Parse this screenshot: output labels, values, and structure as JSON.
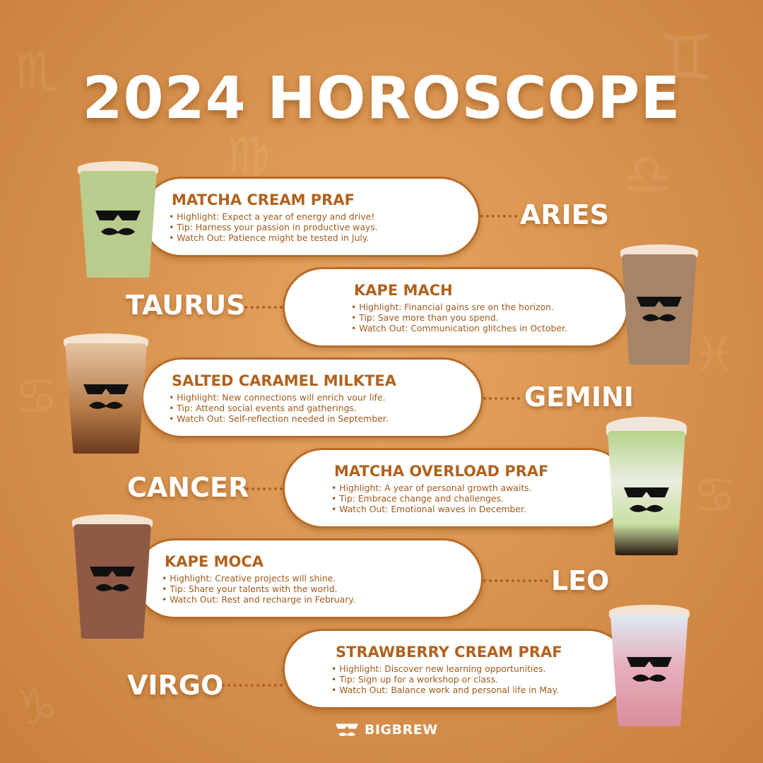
{
  "title": "2024 HOROSCOPE",
  "brand": "BIGBREW",
  "colors": {
    "background": "#d99450",
    "card_border": "#b86b26",
    "card_text": "#a05a1c",
    "sign_text": "#ffffff"
  },
  "entries": [
    {
      "sign": "ARIES",
      "drink": "MATCHA CREAM PRAF",
      "bullets": [
        "Highlight: Expect a year of energy and drive!",
        "Tip: Harness your passion in productive ways.",
        "Watch Out: Patience might be tested in July."
      ],
      "cup_color": "#b9cc8e"
    },
    {
      "sign": "TAURUS",
      "drink": "KAPE MACH",
      "bullets": [
        "Highlight: Financial gains sre on the horizon.",
        "Tip: Save more than you spend.",
        "Watch Out: Communication glitches in October."
      ],
      "cup_color": "#a58468"
    },
    {
      "sign": "GEMINI",
      "drink": "SALTED CARAMEL MILKTEA",
      "bullets": [
        "Highlight: New connections will enrich vour life.",
        "Tip: Attend social events and gatherings.",
        "Watch Out: Self-reflection needed in September."
      ],
      "cup_color": "#c99a70"
    },
    {
      "sign": "CANCER",
      "drink": "MATCHA OVERLOAD PRAF",
      "bullets": [
        "Highlight: A year of personal growth awaits.",
        "Tip: Embrace change and challenges.",
        "Watch Out: Emotional waves in December."
      ],
      "cup_color": "#cfe0b8"
    },
    {
      "sign": "LEO",
      "drink": "KAPE MOCA",
      "bullets": [
        "Highlight: Creative projects will shine.",
        "Tip: Share your talents with the world.",
        "Watch Out: Rest and recharge in February."
      ],
      "cup_color": "#8e5a46"
    },
    {
      "sign": "VIRGO",
      "drink": "STRAWBERRY CREAM PRAF",
      "bullets": [
        "Highlight: Discover new learning opportunities.",
        "Tip: Sign up for a workshop or class.",
        "Watch Out: Balance work and personal life in May."
      ],
      "cup_color": "#e3a3b0"
    }
  ],
  "icons": {
    "mascot": "sunglasses-mustache-icon",
    "background": "zodiac-symbol-icons"
  }
}
